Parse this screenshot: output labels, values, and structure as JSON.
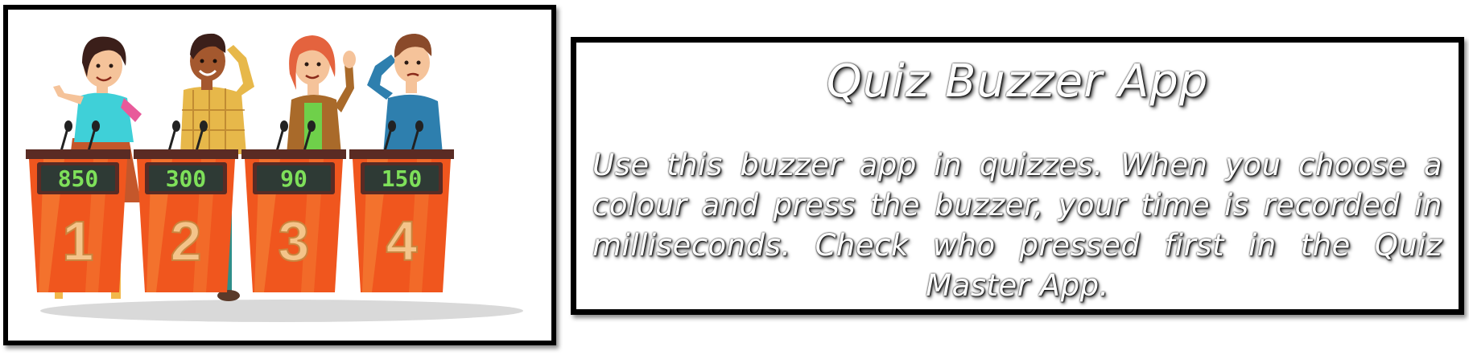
{
  "illustration": {
    "contestants": [
      {
        "podium_number": "1",
        "score": "850"
      },
      {
        "podium_number": "2",
        "score": "300"
      },
      {
        "podium_number": "3",
        "score": "90"
      },
      {
        "podium_number": "4",
        "score": "150"
      }
    ],
    "colors": {
      "podium_orange": "#f0561e",
      "podium_light": "#f68a3a",
      "podium_top": "#5a2b24",
      "screen_bg": "#2e3a35",
      "score_green": "#7ee05a",
      "number_beige": "#f4c48a"
    }
  },
  "info": {
    "title": "Quiz Buzzer App",
    "description": "Use this buzzer app in quizzes. When you choose a colour and press the buzzer, your time is recorded in milliseconds. Check who pressed first in the Quiz Master App."
  }
}
